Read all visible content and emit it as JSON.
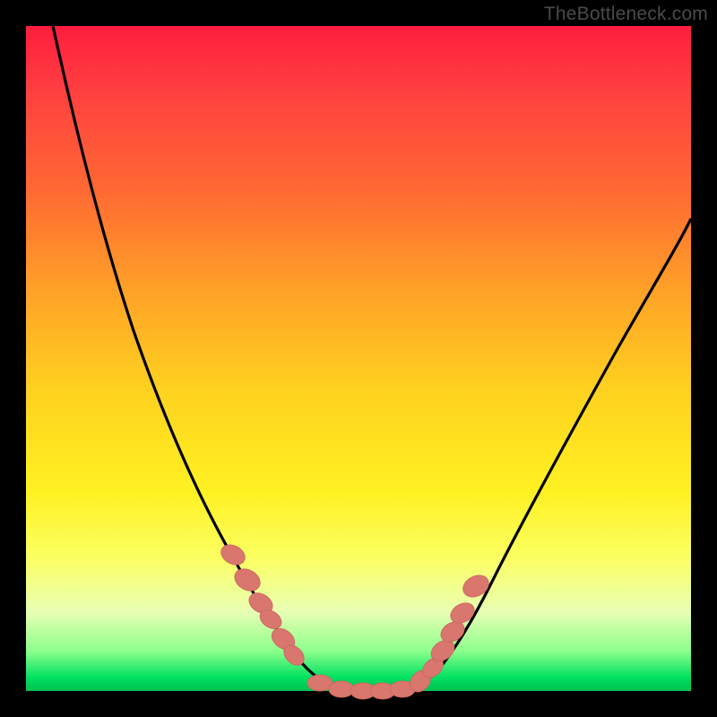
{
  "watermark": "TheBottleneck.com",
  "colors": {
    "frame": "#000000",
    "curve_stroke": "#000000",
    "marker_fill": "#d9776e",
    "marker_stroke": "#cc6a62"
  },
  "chart_data": {
    "type": "line",
    "title": "",
    "xlabel": "",
    "ylabel": "",
    "xlim": [
      0,
      100
    ],
    "ylim": [
      0,
      100
    ],
    "background": "rainbow-vertical-gradient",
    "note": "No axis ticks or numeric labels visible; values below are pixel-space estimates on 0–100 normalized plot area (origin top-left, y increases downward in pixel terms). Curve is a V-shaped profile with flat bottom near y≈100 (bottom of plot).",
    "series": [
      {
        "name": "bottleneck-curve",
        "x": [
          4,
          8,
          14,
          20,
          26,
          30,
          34,
          37,
          40,
          43,
          46,
          50,
          54,
          58,
          60,
          63,
          67,
          72,
          80,
          90,
          100
        ],
        "y": [
          0,
          18,
          40,
          56,
          69,
          77,
          84,
          89,
          93,
          97,
          99,
          100,
          100,
          99,
          97,
          93,
          87,
          78,
          63,
          45,
          28
        ]
      }
    ],
    "markers": {
      "name": "highlight-points",
      "shape": "rounded-capsule",
      "x": [
        31,
        33,
        35,
        36.5,
        38.5,
        40,
        44,
        47,
        50,
        53,
        56,
        59,
        61,
        62.5,
        64,
        65.5,
        67.5
      ],
      "y": [
        79,
        83,
        86.5,
        89,
        92,
        94.5,
        99,
        100,
        100,
        100,
        100,
        98.5,
        96,
        93.5,
        91,
        88,
        84
      ]
    }
  }
}
